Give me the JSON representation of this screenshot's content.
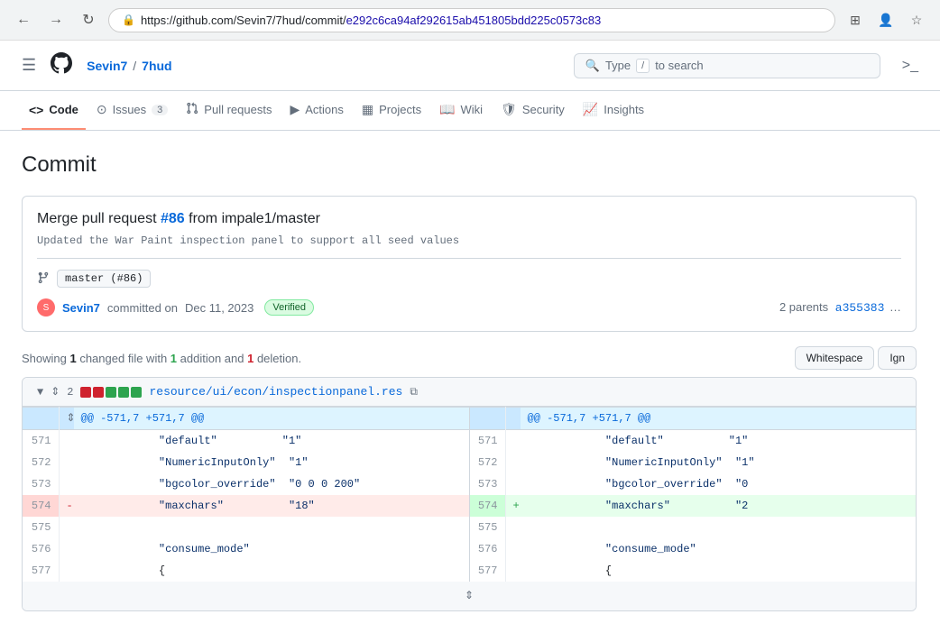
{
  "browser": {
    "url_base": "https://github.com/Sevin7/7hud/commit/",
    "url_hash": "e292c6ca94af292615ab451805bdd225c0573c83"
  },
  "header": {
    "menu_label": "☰",
    "org": "Sevin7",
    "repo": "7hud",
    "breadcrumb_sep": "/",
    "search_placeholder": "Type",
    "search_kbd": "/",
    "search_suffix": "to search"
  },
  "nav": {
    "items": [
      {
        "id": "code",
        "icon": "<>",
        "label": "Code",
        "active": true
      },
      {
        "id": "issues",
        "icon": "⊙",
        "label": "Issues",
        "count": "3"
      },
      {
        "id": "pull-requests",
        "icon": "⎇",
        "label": "Pull requests"
      },
      {
        "id": "actions",
        "icon": "▶",
        "label": "Actions"
      },
      {
        "id": "projects",
        "icon": "▦",
        "label": "Projects"
      },
      {
        "id": "wiki",
        "icon": "📖",
        "label": "Wiki"
      },
      {
        "id": "security",
        "icon": "🛡",
        "label": "Security"
      },
      {
        "id": "insights",
        "icon": "📈",
        "label": "Insights"
      }
    ]
  },
  "page": {
    "title": "Commit"
  },
  "commit": {
    "message_prefix": "Merge pull request ",
    "pr_link": "#86",
    "message_suffix": " from impale1/master",
    "description": "Updated the War Paint inspection panel to support all seed values",
    "branch": "master",
    "branch_pr": "(#86)",
    "author": "Sevin7",
    "action": "committed on",
    "date": "Dec 11, 2023",
    "verified_label": "Verified",
    "parents_prefix": "2 parents",
    "parents_hash1": "a355383",
    "parents_sep": "…"
  },
  "diff": {
    "summary_prefix": "Showing ",
    "changed_count": "1",
    "summary_mid": " changed file with ",
    "additions": "1",
    "summary_mid2": " addition and ",
    "deletions": "1",
    "summary_suffix": " deletion.",
    "whitespace_btn": "Whitespace",
    "ignore_btn": "Ign",
    "file": {
      "name": "resource/ui/econ/inspectionpanel.res",
      "stat_added": 2,
      "stat_removed": 2,
      "stat_unchanged": 3,
      "hunk_header": "@@ -571,7 +571,7 @@"
    },
    "lines": [
      {
        "left_num": "571",
        "right_num": "571",
        "type": "context",
        "left_code": "            \"default\"",
        "right_code": "            \"default\"",
        "left_val": "\"1\"",
        "right_val": "\"1\""
      },
      {
        "left_num": "572",
        "right_num": "572",
        "type": "context",
        "left_code": "            \"NumericInputOnly\"",
        "right_code": "            \"NumericInputOnly\"",
        "left_val": "\"1\"",
        "right_val": "\"1\""
      },
      {
        "left_num": "573",
        "right_num": "573",
        "type": "context",
        "left_code": "            \"bgcolor_override\"",
        "right_code": "            \"bgcolor_override\"",
        "left_val": "\"0 0 0 200\"",
        "right_val": "\"0"
      },
      {
        "left_num": "574",
        "right_num": "574",
        "type": "changed",
        "left_sign": "-",
        "right_sign": "+",
        "left_code": "            \"maxchars\"",
        "right_code": "            \"maxchars\"",
        "left_val": "\"18\"",
        "right_val": "\"2"
      },
      {
        "left_num": "575",
        "right_num": "575",
        "type": "context",
        "left_code": "",
        "right_code": "",
        "left_val": "",
        "right_val": ""
      },
      {
        "left_num": "576",
        "right_num": "576",
        "type": "context",
        "left_code": "            \"consume_mode\"",
        "right_code": "            \"consume_mode\"",
        "left_val": "",
        "right_val": ""
      },
      {
        "left_num": "577",
        "right_num": "577",
        "type": "context",
        "left_code": "            {",
        "right_code": "            {",
        "left_val": "",
        "right_val": ""
      }
    ]
  }
}
